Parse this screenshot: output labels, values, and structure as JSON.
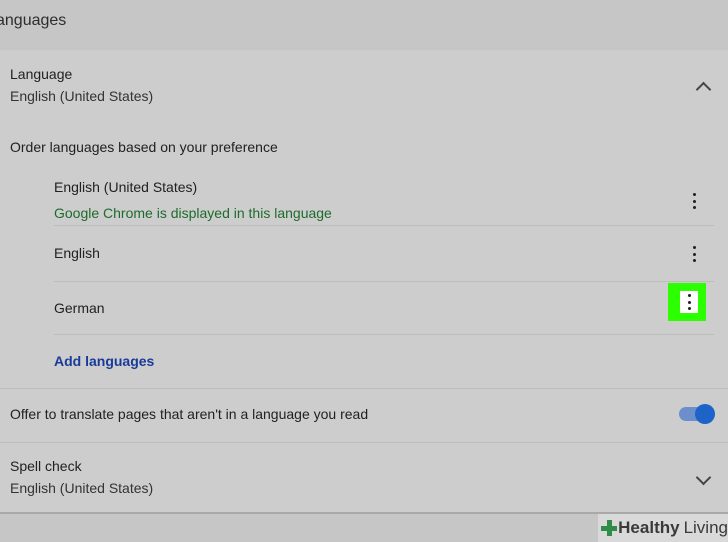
{
  "section": {
    "title": "anguages"
  },
  "language": {
    "label": "Language",
    "value": "English (United States)"
  },
  "order_label": "Order languages based on your preference",
  "languages": [
    {
      "name": "English (United States)",
      "note": "Google Chrome is displayed in this language"
    },
    {
      "name": "English"
    },
    {
      "name": "German"
    }
  ],
  "add_languages": "Add languages",
  "translate": {
    "label": "Offer to translate pages that aren't in a language you read",
    "enabled": true
  },
  "spell_check": {
    "label": "Spell check",
    "value": "English (United States)"
  },
  "watermark": {
    "brand_bold": "Healthy",
    "brand_light": "Living"
  },
  "colors": {
    "highlight": "#2bff00",
    "link": "#1a3a9b",
    "note": "#1d6b2b",
    "toggle": "#1d63c8"
  },
  "icons": [
    "chevron-up-icon",
    "more-vert-icon",
    "chevron-down-icon",
    "cross-logo-icon"
  ]
}
